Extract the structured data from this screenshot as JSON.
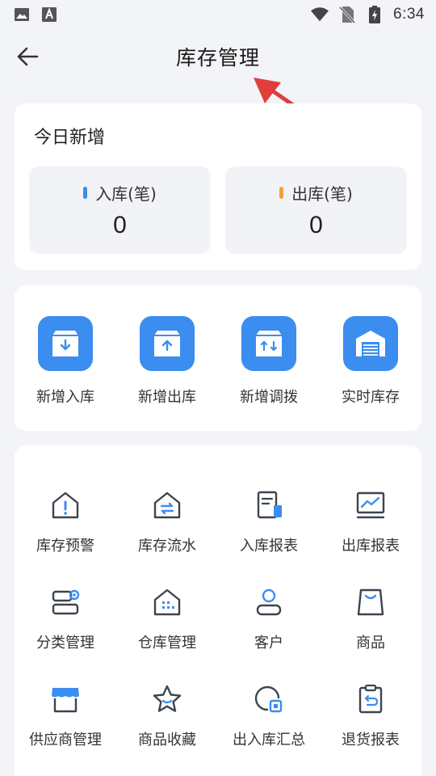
{
  "status_bar": {
    "time": "6:34",
    "left_icons": [
      "image-icon",
      "font-a-icon"
    ],
    "right_icons": [
      "wifi-icon",
      "no-sim-icon",
      "battery-charging-icon"
    ]
  },
  "header": {
    "title": "库存管理",
    "back_icon": "arrow-left-icon"
  },
  "annotation": {
    "type": "red-arrow",
    "color": "#e23d3d",
    "points_to": "page-title"
  },
  "today": {
    "title": "今日新增",
    "stats": [
      {
        "label": "入库(笔)",
        "value": "0",
        "dot_color": "#3b8df0"
      },
      {
        "label": "出库(笔)",
        "value": "0",
        "dot_color": "#f5a03a"
      }
    ]
  },
  "actions": [
    {
      "label": "新增入库",
      "icon": "box-arrow-down-icon"
    },
    {
      "label": "新增出库",
      "icon": "box-arrow-up-icon"
    },
    {
      "label": "新增调拨",
      "icon": "box-transfer-icon"
    },
    {
      "label": "实时库存",
      "icon": "warehouse-icon"
    }
  ],
  "tools": [
    {
      "label": "库存预警",
      "icon": "warning-house-icon"
    },
    {
      "label": "库存流水",
      "icon": "flow-house-icon"
    },
    {
      "label": "入库报表",
      "icon": "in-report-icon"
    },
    {
      "label": "出库报表",
      "icon": "out-report-icon"
    },
    {
      "label": "分类管理",
      "icon": "category-icon"
    },
    {
      "label": "仓库管理",
      "icon": "warehouse-building-icon"
    },
    {
      "label": "客户",
      "icon": "customer-icon"
    },
    {
      "label": "商品",
      "icon": "shopping-bag-icon"
    },
    {
      "label": "供应商管理",
      "icon": "supplier-store-icon"
    },
    {
      "label": "商品收藏",
      "icon": "star-icon"
    },
    {
      "label": "出入库汇总",
      "icon": "summary-pie-icon"
    },
    {
      "label": "退货报表",
      "icon": "return-report-icon"
    }
  ],
  "colors": {
    "accent": "#3b8df0",
    "orange": "#f5a03a",
    "icon_dark": "#3d4450",
    "background": "#f3f4f8"
  }
}
